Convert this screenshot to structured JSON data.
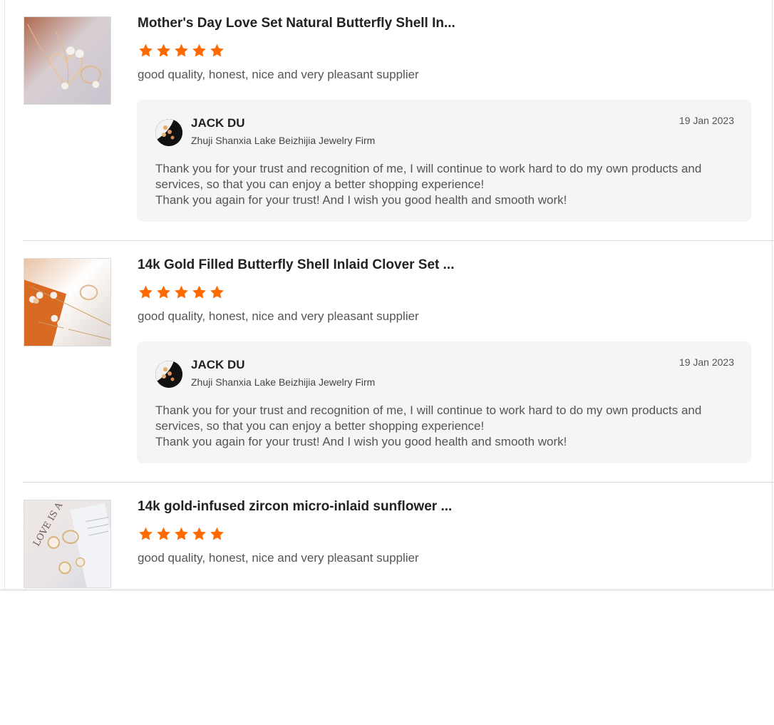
{
  "reviews": [
    {
      "title": "Mother's Day Love Set Natural Butterfly Shell In...",
      "rating": 5,
      "rating_max": 5,
      "text": "good quality, honest, nice and very pleasant supplier",
      "thumbnail_icon": "jewelry-photo-heart-necklace",
      "reply": {
        "seller_name": "JACK DU",
        "company": "Zhuji Shanxia Lake Beizhijia Jewelry Firm",
        "date": "19 Jan 2023",
        "body": [
          "Thank you for your trust and recognition of me, I will continue to work hard to do my own products and services, so that you can enjoy a better shopping experience!",
          "Thank you again for your trust! And I wish you good health and smooth work!"
        ]
      }
    },
    {
      "title": "14k Gold Filled Butterfly Shell Inlaid Clover Set ...",
      "rating": 5,
      "rating_max": 5,
      "text": "good quality, honest, nice and very pleasant supplier",
      "thumbnail_icon": "jewelry-photo-clover-set",
      "reply": {
        "seller_name": "JACK DU",
        "company": "Zhuji Shanxia Lake Beizhijia Jewelry Firm",
        "date": "19 Jan 2023",
        "body": [
          "Thank you for your trust and recognition of me, I will continue to work hard to do my own products and services, so that you can enjoy a better shopping experience!",
          "Thank you again for your trust! And I wish you good health and smooth work!"
        ]
      }
    },
    {
      "title": "14k gold-infused zircon micro-inlaid sunflower ...",
      "rating": 5,
      "rating_max": 5,
      "text": "good quality, honest, nice and very pleasant supplier",
      "thumbnail_icon": "jewelry-photo-sunflower-set"
    }
  ],
  "colors": {
    "star": "#ff6a00",
    "reply_bg": "#f4f5f7",
    "divider": "#dcdcdc"
  }
}
